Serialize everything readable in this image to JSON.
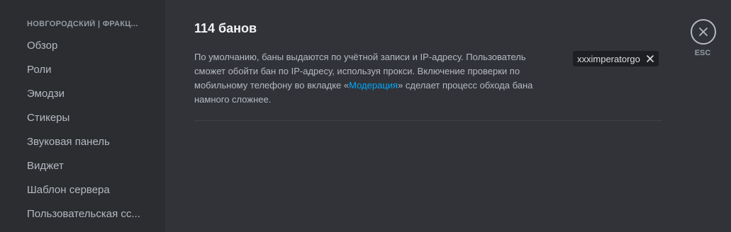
{
  "sidebar": {
    "server_name": "НОВГОРОДСКИЙ | ФРАКЦ...",
    "items": [
      {
        "label": "Обзор"
      },
      {
        "label": "Роли"
      },
      {
        "label": "Эмодзи"
      },
      {
        "label": "Стикеры"
      },
      {
        "label": "Звуковая панель"
      },
      {
        "label": "Виджет"
      },
      {
        "label": "Шаблон сервера"
      },
      {
        "label": "Пользовательская сс..."
      }
    ]
  },
  "main": {
    "title": "114 банов",
    "description_before": "По умолчанию, баны выдаются по учётной записи и IP-адресу. Пользователь сможет обойти бан по IP-адресу, используя прокси. Включение проверки по мобильному телефону во вкладке «",
    "description_link": "Модерация",
    "description_after": "» сделает процесс обхода бана намного сложнее.",
    "search_tag": "xxximperatorgo"
  },
  "close": {
    "esc_label": "ESC"
  },
  "colors": {
    "link": "#00a8fc",
    "sidebar_bg": "#2b2d31",
    "main_bg": "#313338"
  },
  "icons": {
    "tag_close": "x-icon",
    "close_button": "close-circle-icon"
  }
}
